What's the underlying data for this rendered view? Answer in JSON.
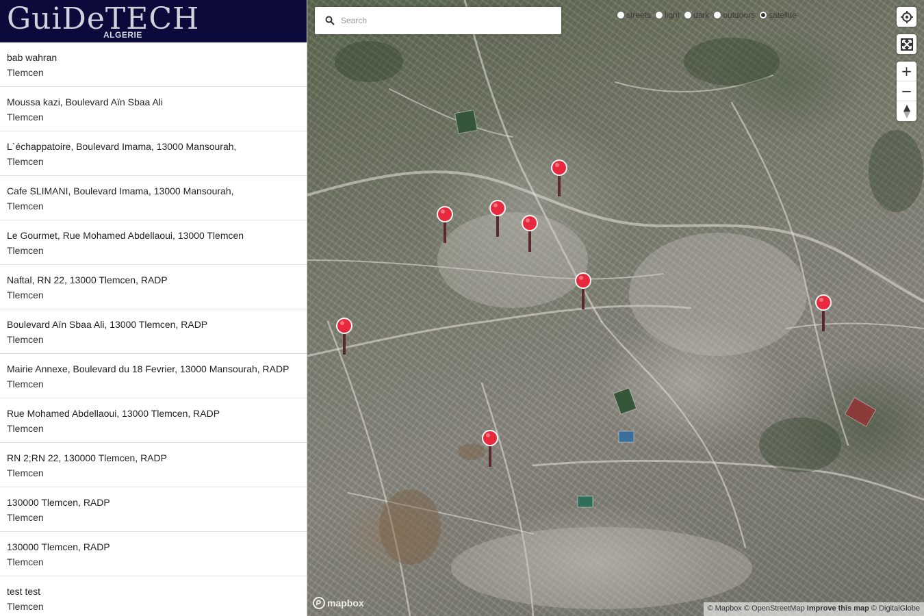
{
  "brand": {
    "logo_text": "GuiDeTECH",
    "logo_sub": "ALGERIE"
  },
  "locations": [
    {
      "name": "bab wahran",
      "city": "Tlemcen"
    },
    {
      "name": "Moussa kazi, Boulevard Aïn Sbaa Ali",
      "city": "Tlemcen"
    },
    {
      "name": "L`échappatoire, Boulevard Imama, 13000 Mansourah,",
      "city": "Tlemcen"
    },
    {
      "name": "Cafe SLIMANI, Boulevard Imama, 13000 Mansourah,",
      "city": "Tlemcen"
    },
    {
      "name": "Le Gourmet, Rue Mohamed Abdellaoui, 13000 Tlemcen",
      "city": "Tlemcen"
    },
    {
      "name": "Naftal, RN 22, 13000 Tlemcen, RADP",
      "city": "Tlemcen"
    },
    {
      "name": "Boulevard Aïn Sbaa Ali, 13000 Tlemcen, RADP",
      "city": "Tlemcen"
    },
    {
      "name": "Mairie Annexe, Boulevard du 18 Fevrier, 13000 Mansourah, RADP",
      "city": "Tlemcen"
    },
    {
      "name": "Rue Mohamed Abdellaoui, 13000 Tlemcen, RADP",
      "city": "Tlemcen"
    },
    {
      "name": "RN 2;RN 22, 130000 Tlemcen, RADP",
      "city": "Tlemcen"
    },
    {
      "name": "130000 Tlemcen, RADP",
      "city": "Tlemcen"
    },
    {
      "name": "130000 Tlemcen, RADP",
      "city": "Tlemcen"
    },
    {
      "name": "test test",
      "city": "Tlemcen"
    }
  ],
  "search": {
    "placeholder": "Search",
    "value": ""
  },
  "map_styles": {
    "options": [
      "streets",
      "light",
      "dark",
      "outdoors",
      "satellite"
    ],
    "selected": "satellite"
  },
  "controls": {
    "zoom_in": "+",
    "zoom_out": "−",
    "compass": "▲"
  },
  "colors": {
    "marker": "#e8283c",
    "logo_bg": "#0b0a3b"
  },
  "attribution": {
    "mapbox_logo": "mapbox",
    "mapbox": "© Mapbox",
    "osm": "© OpenStreetMap",
    "improve": "Improve this map",
    "imagery": "© DigitalGlobe"
  }
}
